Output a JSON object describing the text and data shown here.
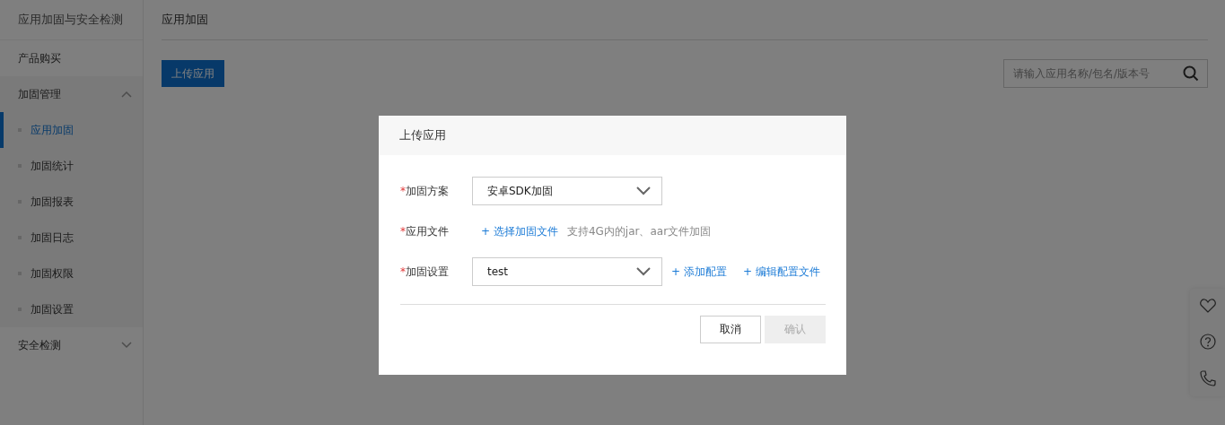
{
  "sidebar": {
    "title": "应用加固与安全检测",
    "items": [
      {
        "label": "产品购买",
        "selected": false
      },
      {
        "label": "加固管理",
        "kind": "group",
        "expanded": true,
        "selected": false,
        "children": [
          {
            "label": "应用加固",
            "selected": true
          },
          {
            "label": "加固统计",
            "selected": false
          },
          {
            "label": "加固报表",
            "selected": false
          },
          {
            "label": "加固日志",
            "selected": false
          },
          {
            "label": "加固权限",
            "selected": false
          },
          {
            "label": "加固设置",
            "selected": false
          }
        ]
      },
      {
        "label": "安全检测",
        "kind": "group",
        "expanded": false,
        "selected": false
      }
    ]
  },
  "header": {
    "title": "应用加固"
  },
  "toolbar": {
    "upload_button": "上传应用",
    "search": {
      "placeholder": "请输入应用名称/包名/版本号"
    }
  },
  "dialog": {
    "title": "上传应用",
    "fields": [
      {
        "kind": "select",
        "required_mark": "*",
        "label": "加固方案",
        "value": "安卓SDK加固"
      },
      {
        "kind": "file",
        "required_mark": "*",
        "label": "应用文件",
        "link": "+ 选择加固文件",
        "hint": "支持4G内的jar、aar文件加固"
      },
      {
        "kind": "select",
        "required_mark": "*",
        "label": "加固设置",
        "value": "test",
        "links": [
          "+ 添加配置",
          "+ 编辑配置文件"
        ]
      }
    ],
    "buttons": [
      {
        "label": "取消",
        "disabled": false
      },
      {
        "label": "确认",
        "disabled": true
      }
    ]
  }
}
